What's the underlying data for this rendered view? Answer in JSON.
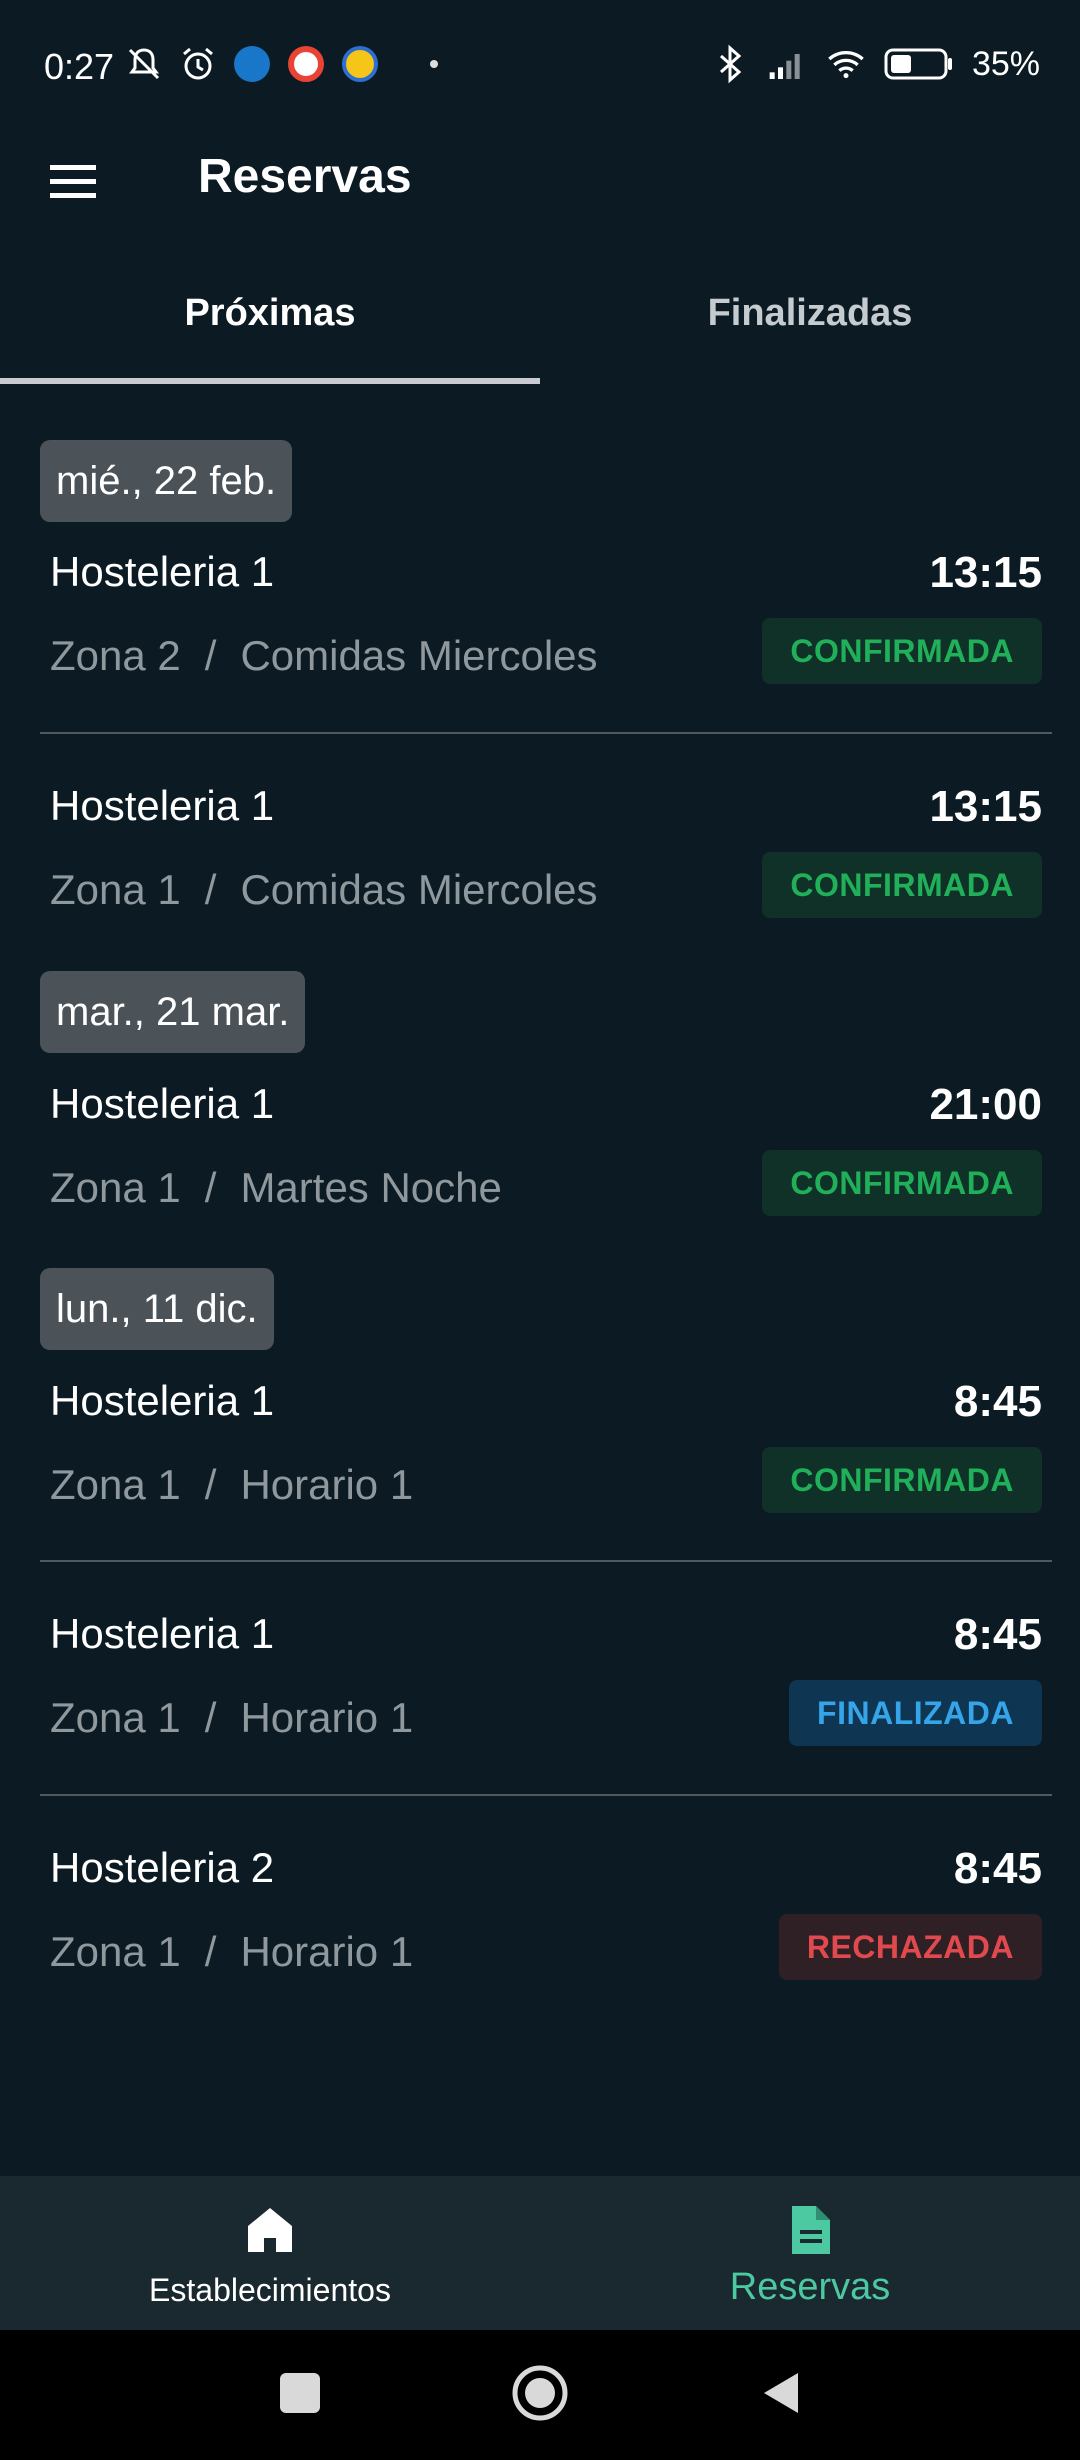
{
  "status_bar": {
    "time": "0:27",
    "battery": "35%",
    "icons_left": [
      "mute-bell-icon",
      "alarm-icon",
      "outlook-icon",
      "google-icon",
      "app-icon"
    ],
    "icons_right": [
      "bluetooth-icon",
      "signal-icon",
      "wifi-icon",
      "battery-icon"
    ]
  },
  "app_bar": {
    "title": "Reservas",
    "menu_icon": "hamburger-menu-icon"
  },
  "tabs": [
    {
      "label": "Próximas",
      "selected": true
    },
    {
      "label": "Finalizadas",
      "selected": false
    }
  ],
  "groups": [
    {
      "date": "mié., 22 feb.",
      "items": [
        {
          "title": "Hosteleria 1",
          "zone": "Zona 2",
          "schedule": "Comidas Miercoles",
          "time": "13:15",
          "status": "CONFIRMADA"
        },
        {
          "title": "Hosteleria 1",
          "zone": "Zona 1",
          "schedule": "Comidas Miercoles",
          "time": "13:15",
          "status": "CONFIRMADA"
        }
      ]
    },
    {
      "date": "mar., 21 mar.",
      "items": [
        {
          "title": "Hosteleria 1",
          "zone": "Zona 1",
          "schedule": "Martes Noche",
          "time": "21:00",
          "status": "CONFIRMADA"
        }
      ]
    },
    {
      "date": "lun., 11 dic.",
      "items": [
        {
          "title": "Hosteleria 1",
          "zone": "Zona 1",
          "schedule": "Horario 1",
          "time": "8:45",
          "status": "CONFIRMADA"
        },
        {
          "title": "Hosteleria 1",
          "zone": "Zona 1",
          "schedule": "Horario 1",
          "time": "8:45",
          "status": "FINALIZADA"
        },
        {
          "title": "Hosteleria 2",
          "zone": "Zona 1",
          "schedule": "Horario 1",
          "time": "8:45",
          "status": "RECHAZADA"
        }
      ]
    }
  ],
  "separator": "/",
  "bottom_nav": [
    {
      "label": "Establecimientos",
      "icon": "home-icon",
      "active": false
    },
    {
      "label": "Reservas",
      "icon": "document-icon",
      "active": true
    }
  ],
  "colors": {
    "background": "#0c1b23",
    "confirmada": "#21b05a",
    "finalizada": "#35a4e8",
    "rechazada": "#e04a4f",
    "accent": "#4cc9a1"
  }
}
